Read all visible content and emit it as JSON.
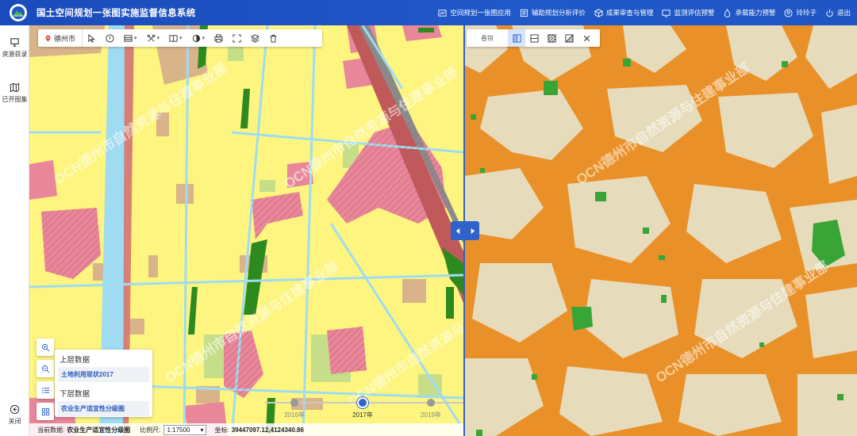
{
  "header": {
    "title": "国土空间规划一张图实施监督信息系统",
    "nav": [
      {
        "label": "空间规划一张图应用",
        "icon": "map-app-icon"
      },
      {
        "label": "辅助规划分析评价",
        "icon": "analysis-icon"
      },
      {
        "label": "成果审查与管理",
        "icon": "cube-icon"
      },
      {
        "label": "监测评估预警",
        "icon": "monitor-icon"
      },
      {
        "label": "承载能力预警",
        "icon": "drop-icon"
      },
      {
        "label": "玲玲子",
        "icon": "user-icon"
      },
      {
        "label": "退出",
        "icon": "power-icon"
      }
    ]
  },
  "sidebar": {
    "items": [
      {
        "label": "资源目录",
        "icon": "catalog-icon"
      },
      {
        "label": "已开图集",
        "icon": "map-book-icon"
      }
    ],
    "close_label": "关闭"
  },
  "toolbar": {
    "city": "德州市",
    "tools": [
      "select-pointer-icon",
      "info-icon",
      "layers-list-icon",
      "measure-tools-icon",
      "split-view-icon",
      "contrast-icon",
      "print-icon",
      "fullscreen-icon",
      "stack-icon",
      "delete-icon"
    ]
  },
  "compare": {
    "label": "卷帘",
    "modes": [
      "vertical-split-icon",
      "horizontal-split-icon",
      "swipe-diagonal-icon",
      "swipe-opacity-icon",
      "close-icon"
    ],
    "active_mode": 0
  },
  "layer_panel": {
    "upper_title": "上层数据",
    "upper_layer": "土地利用现状2017",
    "lower_title": "下层数据",
    "lower_layer": "农业生产适宜性分级图"
  },
  "timeline": {
    "years": [
      "2016年",
      "2017年",
      "2019年"
    ],
    "active_index": 1
  },
  "status": {
    "current_label": "当前数据:",
    "current_value": "农业生产适宜性分级图",
    "scale_label": "比例尺:",
    "scale_value": "1:17500",
    "coord_label": "坐标:",
    "coord_value": "39447097.12,4124340.86"
  },
  "watermark_text": "OCN德州市自然资源与住建事业部",
  "colors": {
    "header_blue": "#1f55c4",
    "accent": "#2f63c9",
    "land_yellow": "#fdf57f",
    "water": "#9fdcf2",
    "residential_pink": "#e8879a",
    "farmland_tan": "#d9b48a",
    "forest_green": "#2d8a1e",
    "suitability_orange": "#e99128",
    "suitability_beige": "#e6dcbc",
    "suitability_green": "#3aa537"
  }
}
